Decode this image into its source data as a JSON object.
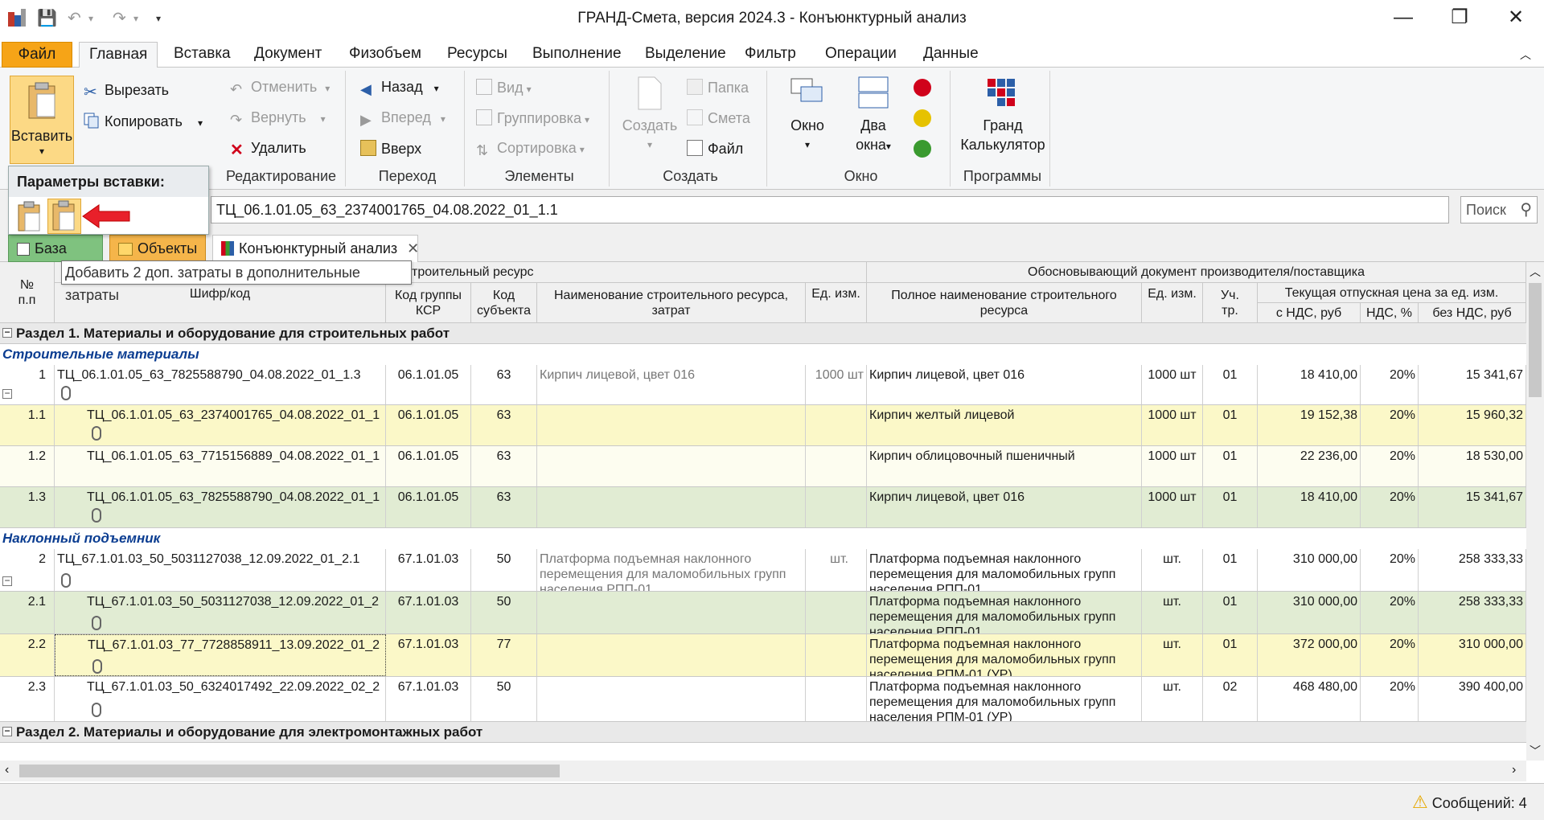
{
  "window": {
    "title": "ГРАНД-Смета, версия 2024.3 - Конъюнктурный анализ",
    "controls": {
      "minimize": "—",
      "restore": "❐",
      "close": "✕"
    }
  },
  "menu": {
    "file": "Файл",
    "tabs": [
      "Главная",
      "Вставка",
      "Документ",
      "Физобъем",
      "Ресурсы",
      "Выполнение",
      "Выделение",
      "Фильтр",
      "Операции",
      "Данные"
    ]
  },
  "ribbon": {
    "paste": "Вставить",
    "clipboard": {
      "cut": "Вырезать",
      "copy": "Копировать"
    },
    "edit": {
      "undo": "Отменить",
      "redo": "Вернуть",
      "delete": "Удалить",
      "label": "Редактирование"
    },
    "nav": {
      "back": "Назад",
      "forward": "Вперед",
      "up": "Вверх",
      "label": "Переход"
    },
    "elements": {
      "view": "Вид",
      "grouping": "Группировка",
      "sort": "Сортировка",
      "label": "Элементы"
    },
    "create": {
      "create": "Создать",
      "folder": "Папка",
      "estimate": "Смета",
      "file": "Файл",
      "label": "Создать"
    },
    "window": {
      "window": "Окно",
      "two1": "Два",
      "two2": "окна",
      "label": "Окно"
    },
    "programs": {
      "g1": "Гранд",
      "g2": "Калькулятор",
      "label": "Программы"
    }
  },
  "paste_popup": {
    "title": "Параметры вставки:"
  },
  "tooltip": "Добавить 2 доп. затраты в дополнительные затраты",
  "path": "ТЦ_06.1.01.05_63_2374001765_04.08.2022_01_1.1",
  "search_placeholder": "Поиск",
  "doc_tabs": {
    "base": "База",
    "objects": "Объекты",
    "analysis": "Конъюнктурный анализ",
    "close": "✕"
  },
  "grid_header": {
    "num1": "№",
    "num2": "п.п",
    "group_left": "троительный ресурс",
    "code": "Шифр/код",
    "ksr1": "Код группы",
    "ksr2": "КСР",
    "subj1": "Код",
    "subj2": "субъекта",
    "name1": "Наименование строительного ресурса,",
    "name2": "затрат",
    "unit": "Ед. изм.",
    "group_right": "Обосновывающий документ производителя/поставщика",
    "fullname1": "Полное наименование строительного",
    "fullname2": "ресурса",
    "unit2": "Ед. изм.",
    "tr1": "Уч.",
    "tr2": "тр.",
    "price": "Текущая отпускная цена за ед. изм.",
    "vat_incl": "с НДС, руб",
    "vat": "НДС, %",
    "vat_excl": "без НДС, руб"
  },
  "sections": [
    {
      "title": "Раздел 1. Материалы  и оборудование для строительных работ"
    },
    {
      "title": "Раздел 2. Материалы и оборудование для электромонтажных работ"
    }
  ],
  "subsections": [
    "Строительные материалы",
    "Наклонный подъемник"
  ],
  "rows": [
    {
      "n": "1",
      "code": "ТЦ_06.1.01.05_63_7825588790_04.08.2022_01_1.3",
      "ksr": "06.1.01.05",
      "subj": "63",
      "name": "Кирпич лицевой, цвет 016",
      "unit": "1000 шт",
      "full": "Кирпич лицевой, цвет 016",
      "unit2": "1000 шт",
      "tr": "01",
      "vin": "18 410,00",
      "vat": "20%",
      "vex": "15 341,67"
    },
    {
      "n": "1.1",
      "code": "ТЦ_06.1.01.05_63_2374001765_04.08.2022_01_1",
      "ksr": "06.1.01.05",
      "subj": "63",
      "name": "",
      "unit": "",
      "full": "Кирпич желтый лицевой",
      "unit2": "1000 шт",
      "tr": "01",
      "vin": "19 152,38",
      "vat": "20%",
      "vex": "15 960,32"
    },
    {
      "n": "1.2",
      "code": "ТЦ_06.1.01.05_63_7715156889_04.08.2022_01_1",
      "ksr": "06.1.01.05",
      "subj": "63",
      "name": "",
      "unit": "",
      "full": "Кирпич облицовочный пшеничный",
      "unit2": "1000 шт",
      "tr": "01",
      "vin": "22 236,00",
      "vat": "20%",
      "vex": "18 530,00"
    },
    {
      "n": "1.3",
      "code": "ТЦ_06.1.01.05_63_7825588790_04.08.2022_01_1",
      "ksr": "06.1.01.05",
      "subj": "63",
      "name": "",
      "unit": "",
      "full": "Кирпич лицевой, цвет 016",
      "unit2": "1000 шт",
      "tr": "01",
      "vin": "18 410,00",
      "vat": "20%",
      "vex": "15 341,67"
    },
    {
      "n": "2",
      "code": "ТЦ_67.1.01.03_50_5031127038_12.09.2022_01_2.1",
      "ksr": "67.1.01.03",
      "subj": "50",
      "name": "Платформа подъемная наклонного перемещения для маломобильных групп населения РПП-01",
      "unit": "шт.",
      "full": "Платформа подъемная наклонного перемещения для маломобильных групп населения РПП-01",
      "unit2": "шт.",
      "tr": "01",
      "vin": "310 000,00",
      "vat": "20%",
      "vex": "258 333,33"
    },
    {
      "n": "2.1",
      "code": "ТЦ_67.1.01.03_50_5031127038_12.09.2022_01_2",
      "ksr": "67.1.01.03",
      "subj": "50",
      "name": "",
      "unit": "",
      "full": "Платформа подъемная наклонного перемещения для маломобильных групп населения РПП-01",
      "unit2": "шт.",
      "tr": "01",
      "vin": "310 000,00",
      "vat": "20%",
      "vex": "258 333,33"
    },
    {
      "n": "2.2",
      "code": "ТЦ_67.1.01.03_77_7728858911_13.09.2022_01_2",
      "ksr": "67.1.01.03",
      "subj": "77",
      "name": "",
      "unit": "",
      "full": "Платформа подъемная наклонного перемещения для маломобильных групп населения РПМ-01 (УР)",
      "unit2": "шт.",
      "tr": "01",
      "vin": "372 000,00",
      "vat": "20%",
      "vex": "310 000,00"
    },
    {
      "n": "2.3",
      "code": "ТЦ_67.1.01.03_50_6324017492_22.09.2022_02_2",
      "ksr": "67.1.01.03",
      "subj": "50",
      "name": "",
      "unit": "",
      "full": "Платформа подъемная наклонного перемещения для маломобильных групп населения РПМ-01 (УР)",
      "unit2": "шт.",
      "tr": "02",
      "vin": "468 480,00",
      "vat": "20%",
      "vex": "390 400,00"
    }
  ],
  "status": {
    "messages": "Сообщений: 4"
  },
  "colors": {
    "file_tab": "#f6a417",
    "yellow_row": "#fbf8c8",
    "green_row": "#e1ecd3",
    "pale_row": "#fdfdf0"
  }
}
